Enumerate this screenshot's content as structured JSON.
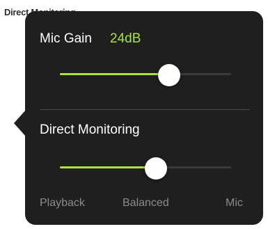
{
  "background_overlap_text": "Direct Monitoring",
  "mic_gain": {
    "label": "Mic Gain",
    "value_text": "24dB",
    "slider_level": 0.64
  },
  "direct_monitoring": {
    "label": "Direct Monitoring",
    "slider_level": 0.56,
    "scale_labels": {
      "left": "Playback",
      "center": "Balanced",
      "right": "Mic"
    }
  },
  "colors": {
    "popover_background": "#1f1f1f",
    "accent": "#a8e63a",
    "track": "#3a3a3a",
    "muted_text": "#8c8c8c",
    "primary_text": "#ffffff"
  }
}
